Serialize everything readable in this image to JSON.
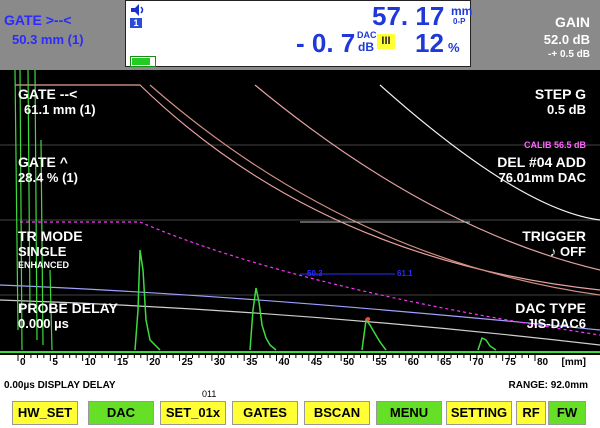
{
  "gate_b": {
    "title": "GATE >--<",
    "value": "50.3 mm (1)"
  },
  "meas": {
    "a": "57. 17",
    "a_unit": "mm",
    "a_sub": "0-P",
    "b": "- 0. 7",
    "b_sup": "DAC",
    "b_unit": "dB",
    "b_badge": "III",
    "c": "12",
    "c_unit": "%",
    "badge1": "1"
  },
  "gain": {
    "label": "GAIN",
    "value": "52.0 dB",
    "step": "-+ 0.5 dB"
  },
  "left_params": [
    {
      "label": "GATE --<",
      "value": "61.1 mm (1)"
    },
    {
      "label": "GATE ^",
      "value": "28.4 % (1)"
    },
    {
      "label": "TR MODE",
      "value": "SINGLE",
      "sub": "ENHANCED"
    },
    {
      "label": "PROBE DELAY",
      "value": "0.000 µs"
    }
  ],
  "right_params": {
    "step_g": {
      "label": "STEP G",
      "value": "0.5 dB"
    },
    "calib": "CALIB  56.5 dB",
    "del": {
      "label": "DEL #04 ADD",
      "value": "76.01mm DAC"
    },
    "trigger": {
      "label": "TRIGGER",
      "value": "♪ OFF"
    },
    "dac_type": {
      "label": "DAC TYPE",
      "value": "JIS-DAC6"
    }
  },
  "gate_markers": {
    "start": "50.3",
    "end": "61.1"
  },
  "axis": {
    "ticks": [
      "0",
      "5",
      "10",
      "15",
      "20",
      "25",
      "30",
      "35",
      "40",
      "45",
      "50",
      "55",
      "60",
      "65",
      "70",
      "75",
      "80"
    ],
    "unit": "[mm]"
  },
  "status": {
    "delay": "0.00µs  DISPLAY DELAY",
    "range": "RANGE: 92.0mm",
    "code": "011"
  },
  "menu": [
    {
      "label": "HW_SET",
      "active": false
    },
    {
      "label": "DAC",
      "active": true
    },
    {
      "label": "SET_01x",
      "active": false
    },
    {
      "label": "GATES",
      "active": false
    },
    {
      "label": "BSCAN",
      "active": false
    },
    {
      "label": "MENU",
      "active": true
    },
    {
      "label": "SETTING",
      "active": false
    },
    {
      "label": "RF",
      "active": false
    },
    {
      "label": "FW",
      "active": true
    }
  ],
  "colors": {
    "trace": "#3ddc3d",
    "gate": "#2b2bff",
    "dac_dash": "#ff33ff",
    "meas_blue": "#1f39d8"
  }
}
